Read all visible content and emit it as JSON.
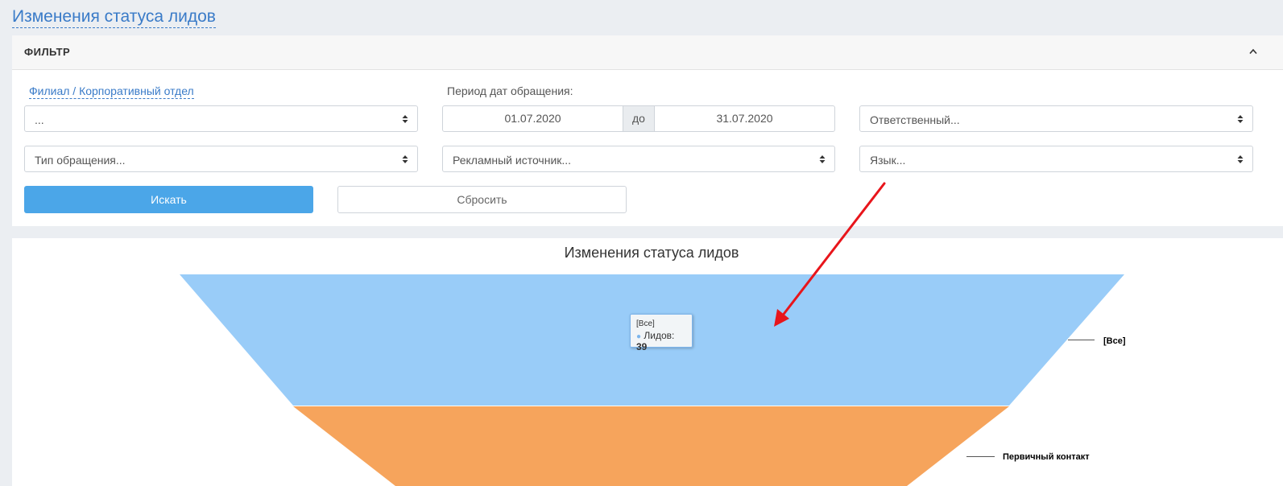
{
  "page": {
    "title": "Изменения статуса лидов"
  },
  "filter": {
    "title": "ФИЛЬТР",
    "branch_label": "Филиал / Корпоративный отдел",
    "branch_value": "...",
    "period_label": "Период дат обращения:",
    "date_from": "01.07.2020",
    "date_sep": "до",
    "date_to": "31.07.2020",
    "responsible_placeholder": "Ответственный...",
    "request_type_placeholder": "Тип обращения...",
    "ad_source_placeholder": "Рекламный источник...",
    "language_placeholder": "Язык...",
    "search_label": "Искать",
    "reset_label": "Сбросить",
    "collapse_icon": "chevron-up-icon"
  },
  "chart": {
    "tooltip": {
      "category": "[Все]",
      "series_label": "Лидов:",
      "value": "39"
    },
    "colors": {
      "all": "#99ccf8",
      "primary_contact": "#f6a45c",
      "arrow": "#e8151b"
    }
  },
  "chart_data": {
    "type": "funnel",
    "title": "Изменения статуса лидов",
    "categories": [
      "[Все]",
      "Первичный контакт"
    ],
    "series": [
      {
        "name": "Лидов",
        "values": [
          39,
          null
        ]
      }
    ]
  }
}
